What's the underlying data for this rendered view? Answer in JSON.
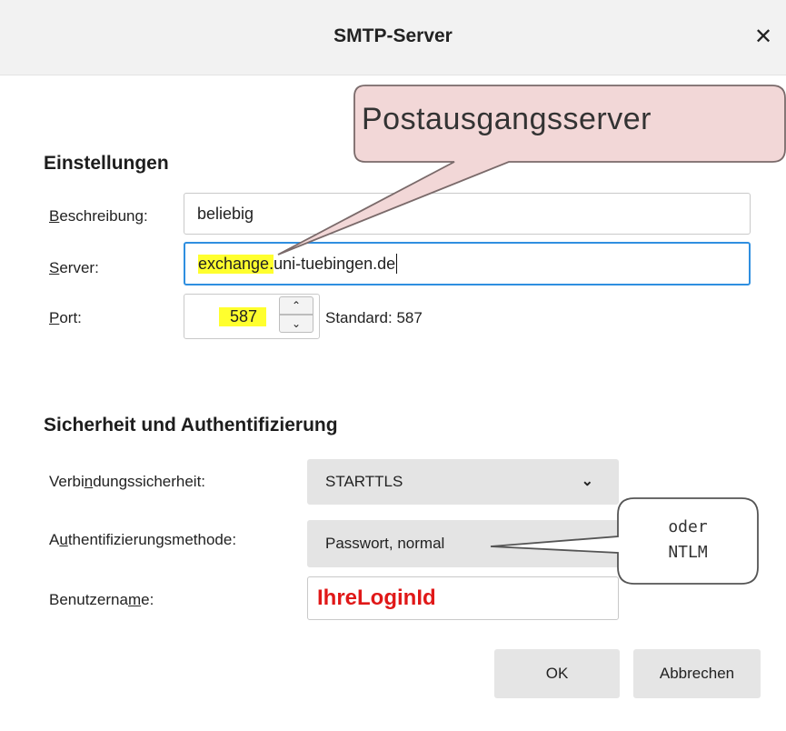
{
  "dialog": {
    "title": "SMTP-Server",
    "close_glyph": "✕"
  },
  "settings": {
    "heading": "Einstellungen",
    "description_label_accesskey": "B",
    "description_label_rest": "eschreibung:",
    "description_value": "beliebig",
    "server_label_accesskey": "S",
    "server_label_rest": "erver:",
    "server_value_highlighted": "exchange.",
    "server_value_rest": "uni-tuebingen.de",
    "port_label_accesskey": "P",
    "port_label_rest": "ort:",
    "port_value": "587",
    "spin_up_glyph": "⌃",
    "spin_down_glyph": "⌄",
    "standard_text": "Standard:  587"
  },
  "security": {
    "heading": "Sicherheit und Authentifizierung",
    "connection_label_pre": "Verbi",
    "connection_label_accesskey": "n",
    "connection_label_post": "dungssicherheit:",
    "connection_value": "STARTTLS",
    "auth_label_pre": "A",
    "auth_label_accesskey": "u",
    "auth_label_post": "thentifizierungsmethode:",
    "auth_value": "Passwort, normal",
    "username_label_pre": "Benutzerna",
    "username_label_accesskey": "m",
    "username_label_post": "e:",
    "username_value": "IhreLoginId"
  },
  "buttons": {
    "ok": "OK",
    "cancel": "Abbrechen"
  },
  "annotations": {
    "server_callout": "Postausgangsserver",
    "auth_callout_line1": "oder",
    "auth_callout_line2": "NTLM"
  },
  "colors": {
    "highlight": "#ffff2e",
    "focus_border": "#2f8fe0",
    "callout_fill": "#f2d7d7",
    "login_text": "#e01818"
  }
}
